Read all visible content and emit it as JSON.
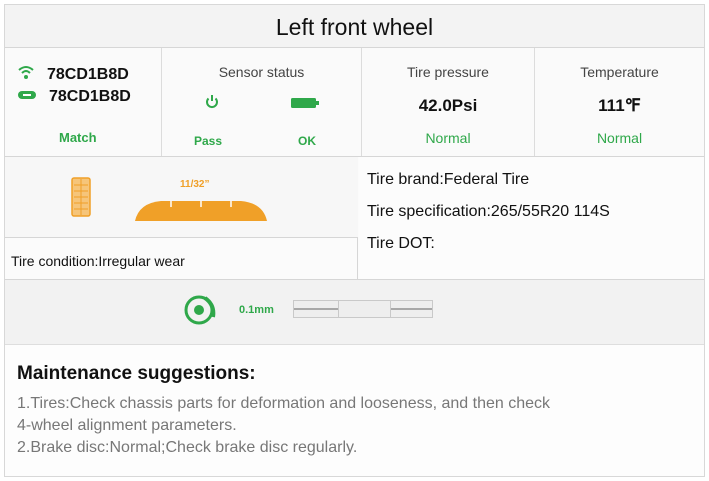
{
  "title": "Left front wheel",
  "sensor_ids": [
    "78CD1B8D",
    "78CD1B8D"
  ],
  "match_label": "Match",
  "sensor_status": {
    "header": "Sensor status",
    "pass_label": "Pass",
    "ok_label": "OK"
  },
  "tire_pressure": {
    "header": "Tire pressure",
    "value": "42.0Psi",
    "status": "Normal"
  },
  "temperature": {
    "header": "Temperature",
    "value": "111℉",
    "status": "Normal"
  },
  "tread": {
    "label": "11/32”",
    "condition": "Tire condition:Irregular wear"
  },
  "tire_info": {
    "brand": "Tire brand:Federal Tire",
    "spec": "Tire specification:265/55R20 114S",
    "dot": "Tire DOT:"
  },
  "brake": {
    "pad_value": "0.1mm"
  },
  "maintenance": {
    "title": "Maintenance suggestions:",
    "lines": [
      "1.Tires:Check chassis parts for deformation and looseness, and then check",
      "4-wheel alignment parameters.",
      "2.Brake disc:Normal;Check brake disc regularly."
    ]
  },
  "colors": {
    "status_green": "#2fa84a",
    "tire_orange": "#f0a028"
  },
  "icons": [
    "wifi-icon",
    "sensor-icon",
    "power-icon",
    "battery-icon",
    "tire-tread-icon",
    "brake-disc-icon"
  ]
}
